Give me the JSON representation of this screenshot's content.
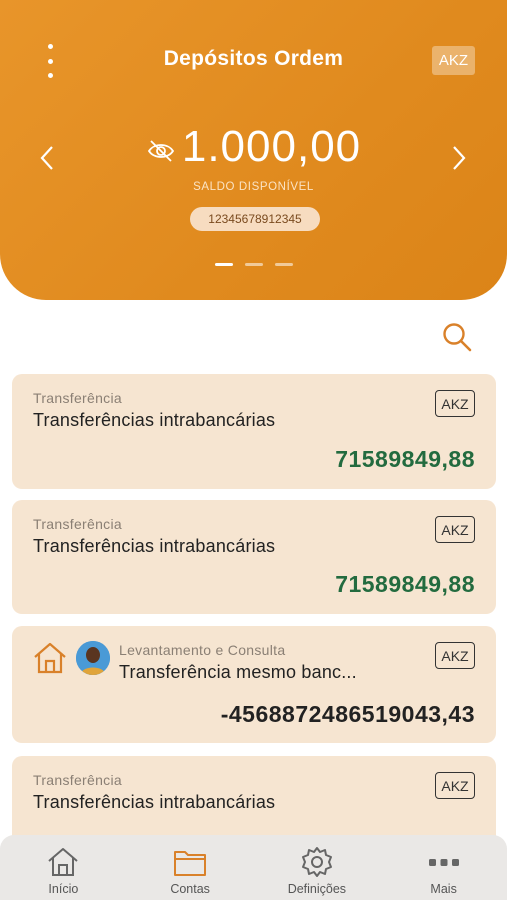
{
  "header": {
    "title": "Depósitos Ordem",
    "currency": "AKZ",
    "balance": "1.000,00",
    "balance_label": "SALDO DISPONÍVEL",
    "account_number": "12345678912345"
  },
  "transactions": [
    {
      "category": "Transferência",
      "title": "Transferências intrabancárias",
      "currency": "AKZ",
      "amount": "71589849,88"
    },
    {
      "category": "Transferência",
      "title": "Transferências intrabancárias",
      "currency": "AKZ",
      "amount": "71589849,88"
    },
    {
      "category": "Levantamento e Consulta",
      "title": "Transferência mesmo banc...",
      "currency": "AKZ",
      "amount": "-4568872486519043,43"
    },
    {
      "category": "Transferência",
      "title": "Transferências intrabancárias",
      "currency": "AKZ",
      "amount": ""
    }
  ],
  "nav": {
    "items": [
      {
        "label": "Início",
        "icon": "home-icon"
      },
      {
        "label": "Contas",
        "icon": "folder-icon"
      },
      {
        "label": "Definições",
        "icon": "gear-icon"
      },
      {
        "label": "Mais",
        "icon": "more-icon"
      }
    ],
    "active": "Contas"
  },
  "colors": {
    "accent": "#e08a1e",
    "card_bg": "#f6e5d1",
    "positive": "#236b3f"
  }
}
